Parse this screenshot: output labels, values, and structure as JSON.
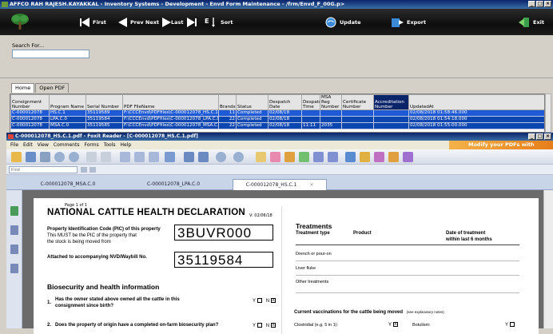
{
  "window": {
    "title": "AFFCO RAH RAJESH.KAYAKKAL - Inventory Systems - Development - Envd Form Maintenance - /frm/Envd_F_00G.p>"
  },
  "toolbar": {
    "first": "First",
    "prev": "Prev Next",
    "last": "Last",
    "sort": "Sort",
    "update": "Update",
    "export": "Export",
    "exit": "Exit"
  },
  "search": {
    "label": "Search For...",
    "value": ""
  },
  "tabs": [
    "Home",
    "Open PDF"
  ],
  "grid": {
    "columns": [
      "Consignment Number",
      "Program Name",
      "Serial Number",
      "PDF FileName",
      "Brands",
      "Status",
      "Despatch Date",
      "Despatch Time",
      "MSA Reg Number",
      "Certificate Number",
      "Accreditation Number",
      "UpdatedAt"
    ],
    "rows": [
      [
        "C-000012078",
        "HS.C.1",
        "35119589",
        "F:\\CCCEnvd\\PDFfiles\\C-000012078_HS.C.1.pdf",
        "11",
        "Completed",
        "02/08/18",
        "",
        "",
        "",
        "",
        "02/08/2018 01:58:46.000"
      ],
      [
        "C-000012078",
        "LPA.C.0",
        "35119584",
        "F:\\CCCEnvd\\PDFfiles\\C-000012078_LPA.C.0.pdf",
        "22",
        "Completed",
        "02/08/18",
        "",
        "",
        "",
        "",
        "02/08/2018 01:54:18.000"
      ],
      [
        "C-000012078",
        "MSA.C.0",
        "35119585",
        "F:\\CCCEnvd\\PDFfiles\\C-000012078_MSA.C.0.pdf",
        "22",
        "Completed",
        "02/08/18",
        "11:11",
        "2035",
        "",
        "",
        "02/08/2018 01:55:00.000"
      ]
    ]
  },
  "reader": {
    "title": "C-000012078_HS.C.1.pdf - Foxit Reader - [C-000012078_HS.C.1.pdf]",
    "menu": [
      "File",
      "Edit",
      "View",
      "Comments",
      "Forms",
      "Tools",
      "Help"
    ],
    "promo": "Modify your PDFs with Phantom",
    "find_placeholder": "Find",
    "doc_tabs": [
      "C-000012078_MSA.C.0",
      "C-000012078_LPA.C.0",
      "C-000012078_HS.C.1"
    ],
    "doc_tab_close": "×"
  },
  "pdf": {
    "page_num": "Page 1 of 1",
    "title": "NATIONAL CATTLE HEALTH DECLARATION",
    "version": "V: 02/06/18",
    "pic_label": "Property Identification Code (PIC) of this property",
    "pic_sub1": "This MUST be the PIC of the property that",
    "pic_sub2": "the stock is being moved from",
    "pic_value": "3BUVR000",
    "nvd_label": "Attached to accompanying NVD/Waybill No.",
    "nvd_value": "35119584",
    "bio_heading": "Biosecurity and health information",
    "q1_num": "1.",
    "q1": "Has the owner stated above owned all the cattle in this",
    "q1b": "consignment since birth?",
    "q2_num": "2.",
    "q2": "Does the property of origin have a completed on-farm biosecurity plan?",
    "yes": "Y",
    "no": "N",
    "x_mark": "X",
    "treat_heading": "Treatments",
    "col_type": "Treatment type",
    "col_product": "Product",
    "col_date1": "Date of treatment",
    "col_date2": "within last 6 months",
    "row1": "Drench or pour-on",
    "row2": "Liver fluke",
    "row3": "Other treatments",
    "vacc_heading": "Current vaccinations for the cattle being moved",
    "vacc_note": "(see explanatory notes)",
    "clos": "Clostridial (e.g. 5 in 1):",
    "botulism": "Botulism:"
  }
}
